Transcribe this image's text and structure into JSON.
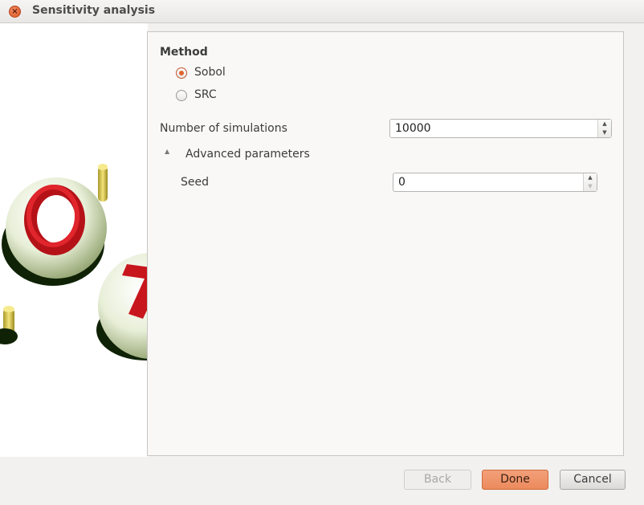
{
  "window": {
    "title": "Sensitivity analysis",
    "close_icon": "close-icon"
  },
  "form": {
    "method_label": "Method",
    "methods": [
      {
        "label": "Sobol",
        "checked": true
      },
      {
        "label": "SRC",
        "checked": false
      }
    ],
    "num_simulations": {
      "label": "Number of simulations",
      "value": "10000"
    },
    "advanced": {
      "label": "Advanced parameters",
      "expanded": true
    },
    "seed": {
      "label": "Seed",
      "value": "0"
    }
  },
  "buttons": {
    "back": "Back",
    "done": "Done",
    "cancel": "Cancel"
  },
  "colors": {
    "accent": "#e0632f",
    "logo_red": "#c8161d",
    "logo_yellow": "#d9c64a"
  }
}
